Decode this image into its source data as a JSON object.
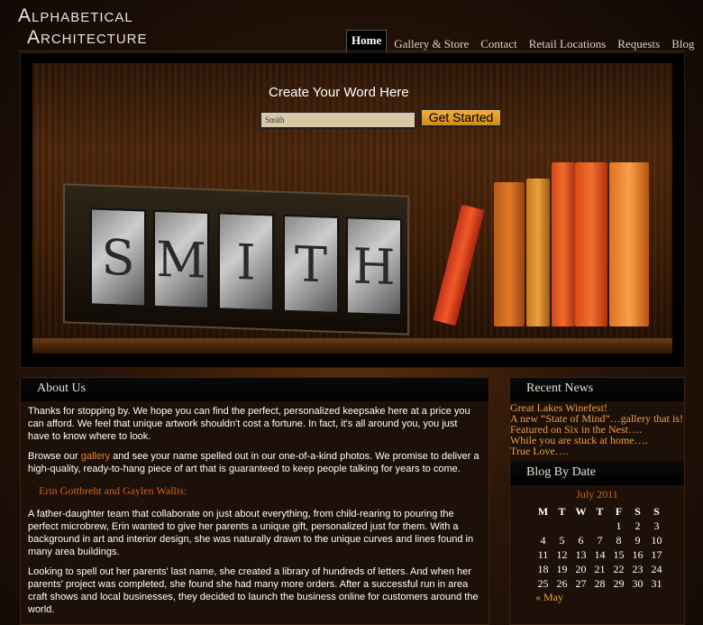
{
  "site": {
    "logo_line1": "Alphabetical",
    "logo_line2": "Architecture"
  },
  "nav": [
    {
      "label": "Home",
      "active": true
    },
    {
      "label": "Gallery & Store",
      "active": false
    },
    {
      "label": "Contact",
      "active": false
    },
    {
      "label": "Retail Locations",
      "active": false
    },
    {
      "label": "Requests",
      "active": false
    },
    {
      "label": "Blog",
      "active": false
    }
  ],
  "hero": {
    "title": "Create Your Word Here",
    "input_value": "Smith",
    "button_label": "Get Started"
  },
  "about": {
    "heading": "About Us",
    "p1": "Thanks for stopping by. We hope you can find the perfect, personalized keepsake here at a price you can afford. We feel that unique artwork shouldn't cost a fortune. In fact, it's all around you, you just have to know where to look.",
    "p2_before": "Browse our ",
    "p2_link": "gallery",
    "p2_after": " and see your name spelled out in our one-of-a-kind photos. We promise to deliver a high-quality, ready-to-hang piece of art that is guaranteed to keep people talking for years to come.",
    "subheading": "Erin Gottbreht and Gaylen Wallis:",
    "p3": "A father-daughter team that collaborate on just about everything, from child-rearing to pouring the perfect microbrew, Erin wanted to give her parents a unique gift, personalized just for them. With a background in art and interior design, she was naturally drawn to the unique curves and lines found in many area buildings.",
    "p4": "Looking to spell out her parents' last name, she created a library of hundreds of letters. And when her parents' project was completed, she found she had many more orders. After a successful run in area craft shows and local businesses, they decided to launch the business online for customers around the world."
  },
  "news": {
    "heading": "Recent News",
    "items": [
      "Great Lakes Winefest!",
      "A new “State of Mind”…gallery that is!",
      "Featured on Six in the Nest….",
      "While you are stuck at home….",
      "True Love…."
    ]
  },
  "calendar": {
    "heading": "Blog By Date",
    "month": "July 2011",
    "weekdays": [
      "M",
      "T",
      "W",
      "T",
      "F",
      "S",
      "S"
    ],
    "weeks": [
      [
        "",
        "",
        "",
        "",
        "1",
        "2",
        "3"
      ],
      [
        "4",
        "5",
        "6",
        "7",
        "8",
        "9",
        "10"
      ],
      [
        "11",
        "12",
        "13",
        "14",
        "15",
        "16",
        "17"
      ],
      [
        "18",
        "19",
        "20",
        "21",
        "22",
        "23",
        "24"
      ],
      [
        "25",
        "26",
        "27",
        "28",
        "29",
        "30",
        "31"
      ]
    ],
    "prev_link": "« May"
  },
  "colors": {
    "accent_orange": "#f0a040",
    "subhead_orange": "#d4631a",
    "button_gold": "#e0a030"
  }
}
